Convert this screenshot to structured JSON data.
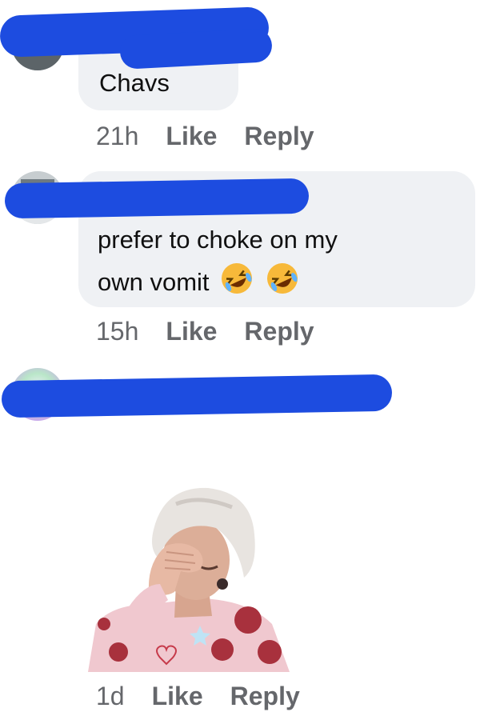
{
  "comments": [
    {
      "text": "Chavs",
      "time": "21h",
      "like": "Like",
      "reply": "Reply"
    },
    {
      "text_line1": "prefer to choke on my",
      "text_line2": "own vomit",
      "emojis": [
        "rolling-on-floor-laughing-emoji",
        "rolling-on-floor-laughing-emoji"
      ],
      "time": "15h",
      "like": "Like",
      "reply": "Reply"
    },
    {
      "sticker": "facepalm-sticker",
      "time": "1d",
      "like": "Like",
      "reply": "Reply"
    }
  ],
  "colors": {
    "bubble": "#eff1f4",
    "meta": "#65676b",
    "redaction": "#1d4ce0"
  }
}
